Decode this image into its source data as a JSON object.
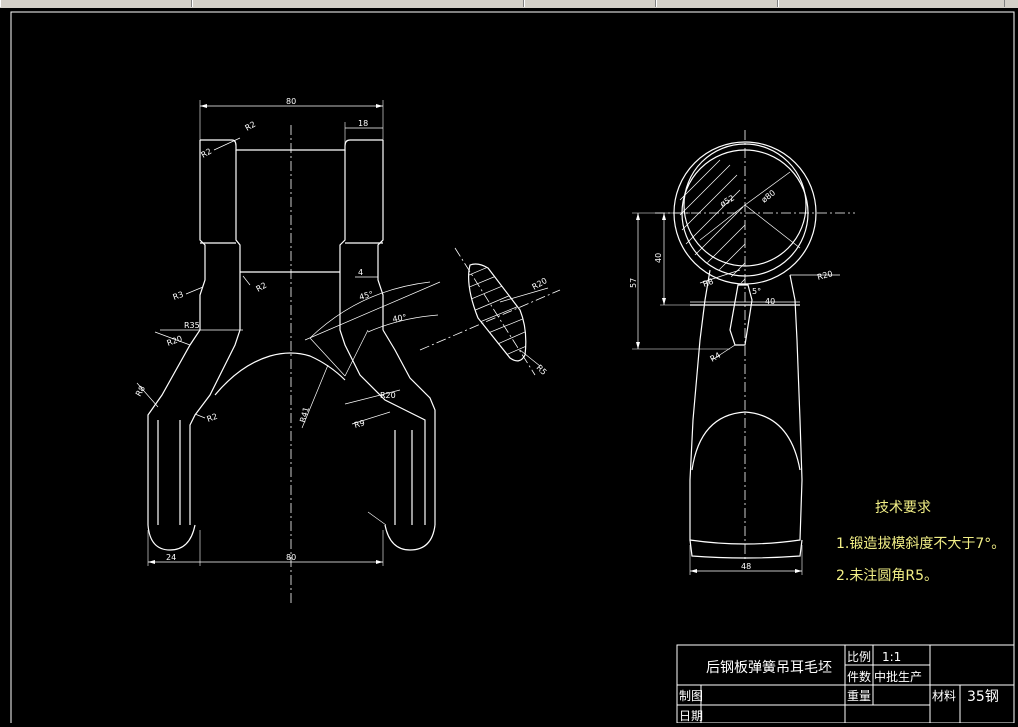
{
  "drawing": {
    "front_view": {
      "top_width": "80",
      "shoulder_width": "18",
      "radius_top_left": "R2",
      "radius_top_right": "R2",
      "radius_upper_left": "R2",
      "radius_shoulder": "R3",
      "radius_r35": "R35",
      "radius_r20_left": "R20",
      "radius_r8_left": "R8",
      "radius_r2_left_lower": "R2",
      "radius_r41": "R41",
      "radius_r20_right": "R20",
      "radius_r9": "R9",
      "gap_4": "4",
      "angle_45": "45°",
      "angle_40": "40°",
      "bottom_foot": "24",
      "bottom_width": "80"
    },
    "section_view": {
      "radius_r20": "R20",
      "radius_r5": "R5"
    },
    "side_view": {
      "dia_52": "ø52",
      "dia_80": "ø80",
      "height_57": "57",
      "height_40": "40",
      "radius_r8": "R8",
      "radius_r20": "R20",
      "angle_5": "5°",
      "width_40": "40",
      "radius_r4": "R4",
      "bottom_width": "48"
    }
  },
  "notes": {
    "heading": "技术要求",
    "line1": "1.锻造拔模斜度不大于7°。",
    "line2": "2.未注圆角R5。"
  },
  "title_block": {
    "part_name": "后钢板弹簧吊耳毛坯",
    "scale_label": "比例",
    "scale_value": "1:1",
    "qty_label": "件数",
    "qty_value": "中批生产",
    "draw_label": "制图",
    "weight_label": "重量",
    "material_label": "材料",
    "material_value": "35钢",
    "date_label": "日期"
  },
  "colors": {
    "background": "#000000",
    "lines": "#ffffff",
    "notes_text": "#f2ef86"
  }
}
